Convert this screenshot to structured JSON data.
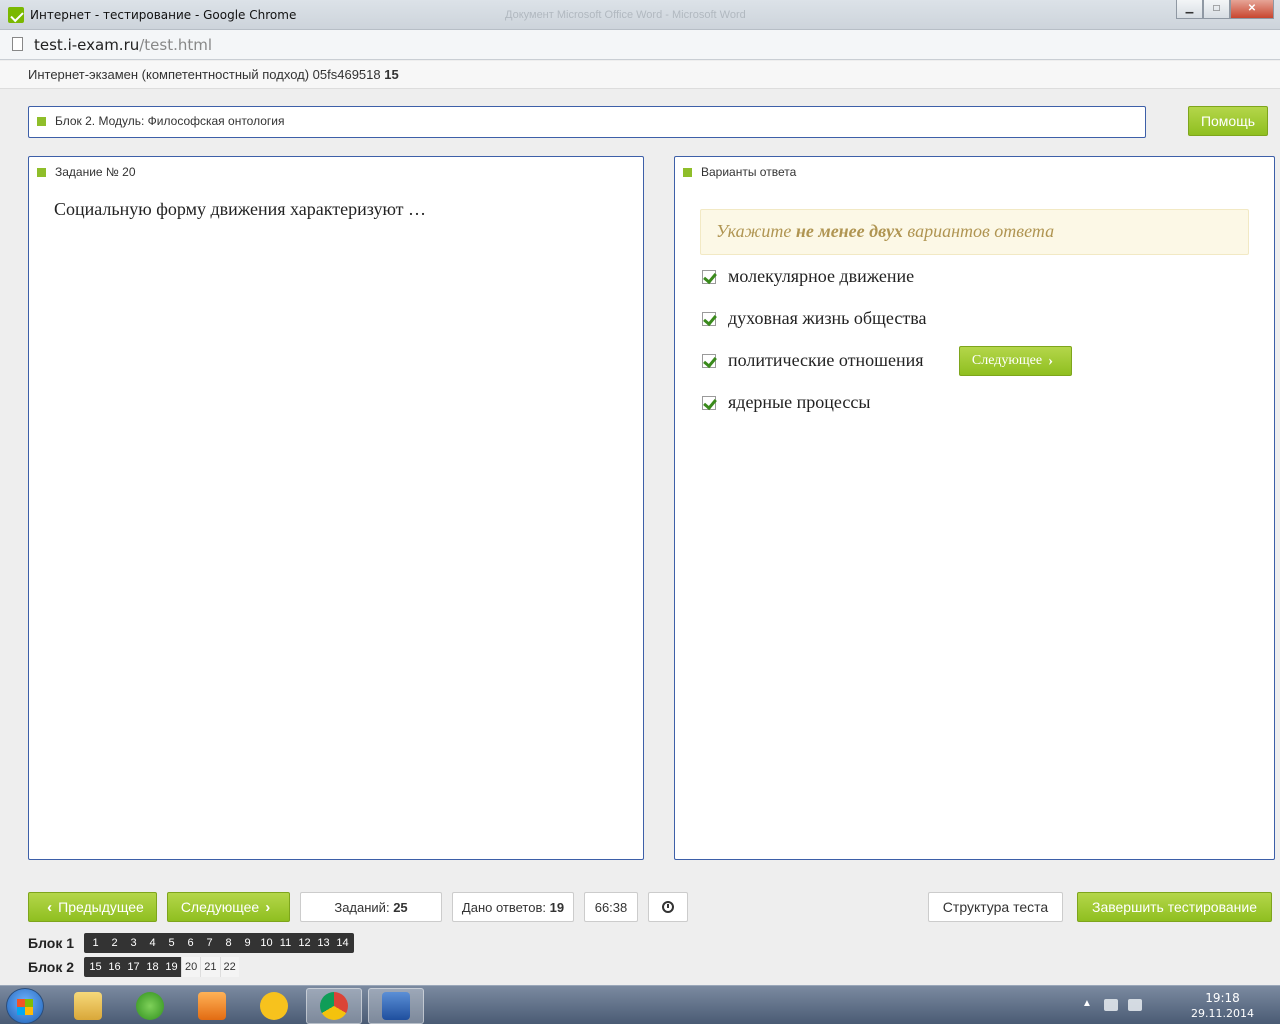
{
  "window": {
    "title": "Интернет - тестирование - Google Chrome",
    "ghost_title": "Документ Microsoft Office Word - Microsoft Word"
  },
  "address": {
    "host": "test.i-exam.ru",
    "path": "/test.html"
  },
  "exam": {
    "title": "Интернет-экзамен (компетентностный подход) 05fs469518",
    "number": "15"
  },
  "block_header": {
    "label": "Блок 2. Модуль: Философская онтология"
  },
  "help_label": "Помощь",
  "task": {
    "label": "Задание № 20",
    "question": "Социальную форму движения характеризуют …"
  },
  "answers": {
    "label": "Варианты ответа",
    "hint_pre": "Укажите ",
    "hint_bold": "не менее двух",
    "hint_post": " вариантов ответа",
    "options": [
      {
        "text": "молекулярное движение",
        "checked": true
      },
      {
        "text": "духовная жизнь общества",
        "checked": true
      },
      {
        "text": "политические отношения",
        "checked": true
      },
      {
        "text": "ядерные процессы",
        "checked": true
      }
    ],
    "next_inline": "Следующее"
  },
  "nav": {
    "prev": "Предыдущее",
    "next": "Следующее",
    "tasks_label": "Заданий:",
    "tasks_count": "25",
    "answered_label": "Дано ответов:",
    "answered_count": "19",
    "timer": "66:38",
    "structure": "Структура теста",
    "finish": "Завершить тестирование"
  },
  "blocks": [
    {
      "label": "Блок 1",
      "items": [
        "1",
        "2",
        "3",
        "4",
        "5",
        "6",
        "7",
        "8",
        "9",
        "10",
        "11",
        "12",
        "13",
        "14"
      ],
      "answered": 14
    },
    {
      "label": "Блок 2",
      "items": [
        "15",
        "16",
        "17",
        "18",
        "19",
        "20",
        "21",
        "22"
      ],
      "answered": 5
    }
  ],
  "taskbar": {
    "time": "19:18",
    "date": "29.11.2014"
  },
  "colors": {
    "accent_green": "#8fbf20",
    "panel_border": "#3d5fa8",
    "hint_bg": "#fcf8e6",
    "hint_text": "#b09552"
  }
}
